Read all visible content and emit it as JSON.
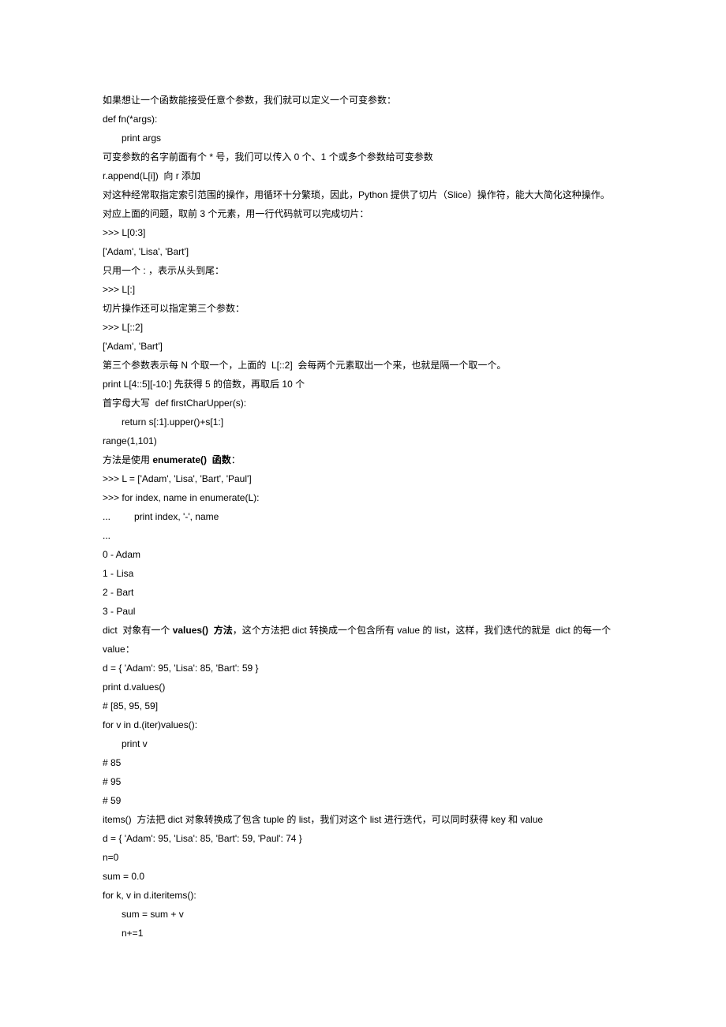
{
  "lines": [
    {
      "text": "如果想让一个函数能接受任意个参数，我们就可以定义一个可变参数："
    },
    {
      "text": "def fn(*args):"
    },
    {
      "text": "print args",
      "indent": true
    },
    {
      "text": "可变参数的名字前面有个 * 号，我们可以传入 0 个、1 个或多个参数给可变参数"
    },
    {
      "text": "r.append(L[i])  向 r 添加"
    },
    {
      "text": "对这种经常取指定索引范围的操作，用循环十分繁琐，因此，Python 提供了切片（Slice）操作符，能大大简化这种操作。"
    },
    {
      "text": "对应上面的问题，取前 3 个元素，用一行代码就可以完成切片："
    },
    {
      "text": ">>> L[0:3]"
    },
    {
      "text": "['Adam', 'Lisa', 'Bart']"
    },
    {
      "text": "只用一个 : ，表示从头到尾："
    },
    {
      "text": ">>> L[:]"
    },
    {
      "text": "切片操作还可以指定第三个参数："
    },
    {
      "text": ">>> L[::2]"
    },
    {
      "text": "['Adam', 'Bart']"
    },
    {
      "text": "第三个参数表示每 N 个取一个，上面的  L[::2]  会每两个元素取出一个来，也就是隔一个取一个。"
    },
    {
      "text": "print L[4::5][-10:] 先获得 5 的倍数，再取后 10 个"
    },
    {
      "text": "首字母大写  def firstCharUpper(s):"
    },
    {
      "text": "return s[:1].upper()+s[1:]",
      "indent": true
    },
    {
      "text": "range(1,101)"
    },
    {
      "segments": [
        {
          "t": "方法是使用 "
        },
        {
          "t": "enumerate()  函数",
          "b": true
        },
        {
          "t": "："
        }
      ]
    },
    {
      "text": ">>> L = ['Adam', 'Lisa', 'Bart', 'Paul']"
    },
    {
      "text": ">>> for index, name in enumerate(L):"
    },
    {
      "text": "...         print index, '-', name"
    },
    {
      "text": "..."
    },
    {
      "text": "0 - Adam"
    },
    {
      "text": "1 - Lisa"
    },
    {
      "text": "2 - Bart"
    },
    {
      "text": "3 - Paul"
    },
    {
      "segments": [
        {
          "t": "dict  对象有一个 "
        },
        {
          "t": "values()  方法",
          "b": true
        },
        {
          "t": "，这个方法把 dict 转换成一个包含所有 value 的 list，这样，我们迭代的就是  dict 的每一个  value："
        }
      ]
    },
    {
      "text": "d = { 'Adam': 95, 'Lisa': 85, 'Bart': 59 }"
    },
    {
      "text": "print d.values()"
    },
    {
      "text": "# [85, 95, 59]"
    },
    {
      "text": "for v in d.(iter)values():"
    },
    {
      "text": "print v",
      "indent": true
    },
    {
      "text": "# 85"
    },
    {
      "text": "# 95"
    },
    {
      "text": "# 59"
    },
    {
      "text": "items()  方法把 dict 对象转换成了包含 tuple 的 list，我们对这个 list 进行迭代，可以同时获得 key 和 value"
    },
    {
      "text": "d = { 'Adam': 95, 'Lisa': 85, 'Bart': 59, 'Paul': 74 }"
    },
    {
      "text": "n=0"
    },
    {
      "text": "sum = 0.0"
    },
    {
      "text": "for k, v in d.iteritems():"
    },
    {
      "text": "sum = sum + v",
      "indent": true
    },
    {
      "text": "n+=1",
      "indent": true
    }
  ]
}
